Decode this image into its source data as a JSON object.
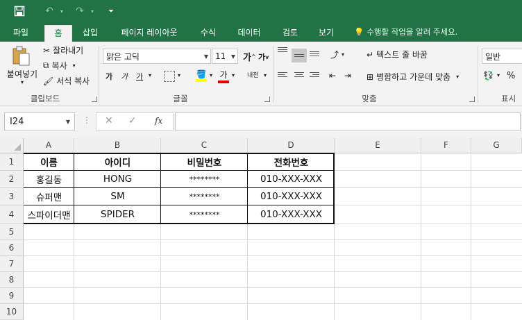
{
  "tabs": [
    "파일",
    "홈",
    "삽입",
    "페이지 레이아웃",
    "수식",
    "데이터",
    "검토",
    "보기"
  ],
  "tell_me": "수행할 작업을 알려 주세요.",
  "clipboard": {
    "paste": "붙여넣기",
    "cut": "잘라내기",
    "copy": "복사",
    "format_painter": "서식 복사",
    "label": "클립보드"
  },
  "font": {
    "name": "맑은 고딕",
    "size": "11",
    "grow": "가",
    "shrink": "가",
    "bold": "가",
    "italic": "가",
    "underline": "가",
    "font_color": "가",
    "phonetic": "내천",
    "label": "글꼴"
  },
  "alignment": {
    "wrap": "텍스트 줄 바꿈",
    "merge": "병합하고 가운데 맞춤",
    "label": "맞춤"
  },
  "number": {
    "format": "일반",
    "percent": "%",
    "label": "표시"
  },
  "formula_bar": {
    "name_box": "I24",
    "fx": "fx",
    "content": ""
  },
  "columns": [
    "A",
    "B",
    "C",
    "D",
    "E",
    "F",
    "G"
  ],
  "rows": [
    "1",
    "2",
    "3",
    "4",
    "5",
    "6",
    "7",
    "8",
    "9",
    "10"
  ],
  "table": {
    "headers": [
      "이름",
      "아이디",
      "비밀번호",
      "전화번호"
    ],
    "rows": [
      [
        "홍길동",
        "HONG",
        "********",
        "010-XXX-XXX"
      ],
      [
        "슈퍼맨",
        "SM",
        "********",
        "010-XXX-XXX"
      ],
      [
        "스파이더맨",
        "SPIDER",
        "********",
        "010-XXX-XXX"
      ]
    ]
  },
  "colors": {
    "accent": "#217346",
    "ribbon_bg": "#f3f3f3",
    "header_bg": "#f0f0f0"
  }
}
